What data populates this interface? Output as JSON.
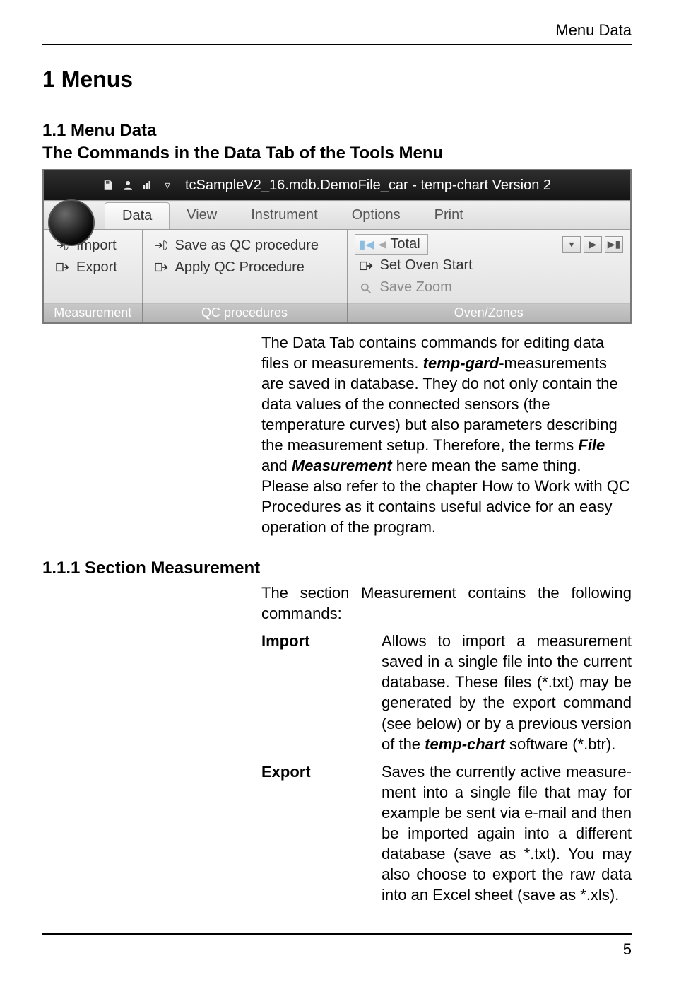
{
  "header": {
    "section": "Menu Data"
  },
  "h1": "1    Menus",
  "h2": "1.1   Menu Data",
  "subtitle": "The Commands in the Data Tab of the Tools Menu",
  "ribbon": {
    "titlebar": {
      "qa_icons": [
        "save-icon",
        "user-icon",
        "bars-icon"
      ],
      "chevron": "▿",
      "title": "tcSampleV2_16.mdb.DemoFile_car - temp-chart Version 2"
    },
    "tabs": [
      "Data",
      "View",
      "Instrument",
      "Options",
      "Print"
    ],
    "active_tab": 0,
    "group1": {
      "import": "Import",
      "export": "Export",
      "label": "Measurement"
    },
    "group2": {
      "save_qc": "Save as QC procedure",
      "apply_qc": "Apply QC Procedure",
      "label": "QC procedures"
    },
    "group3": {
      "total": "Total",
      "set_oven": "Set Oven Start",
      "save_zoom": "Save Zoom",
      "label": "Oven/Zones"
    }
  },
  "para1": "The Data Tab contains commands for editing data files or measurements. ",
  "para1_em": "temp-gard",
  "para1b": "-measurements are saved in database. They do not only contain the data values of the connected sensors (the temperature curves) but also parameters descri­bing the measurement setup. Therefore, the terms ",
  "para1_em2": "File",
  "para1c": " and ",
  "para1_em3": "Measurement",
  "para1d": " here mean the same thing. Please also refer to the chapter How to Work with QC Procedures  as it contains useful advice for an easy operation of the program.",
  "h3": "1.1.1  Section Measurement",
  "sm_intro": "The section Measurement contains   the   following commands:",
  "commands": [
    {
      "label": "Import",
      "desc_a": "Allows to import a measurement saved in a single file into the current database. These files (*.txt) may be generated by the export command (see below) or by a previous ver­sion of the ",
      "desc_em": "temp-chart",
      "desc_b": " software (*.btr)."
    },
    {
      "label": "Export",
      "desc_a": "Saves the currently active measure­ment into a single file that may for example be sent via e-mail and then be imported again into a diffe­rent database (save as *.txt). You may also choose to export the raw data into an Excel sheet (save as *.xls).",
      "desc_em": "",
      "desc_b": ""
    }
  ],
  "page_number": "5"
}
